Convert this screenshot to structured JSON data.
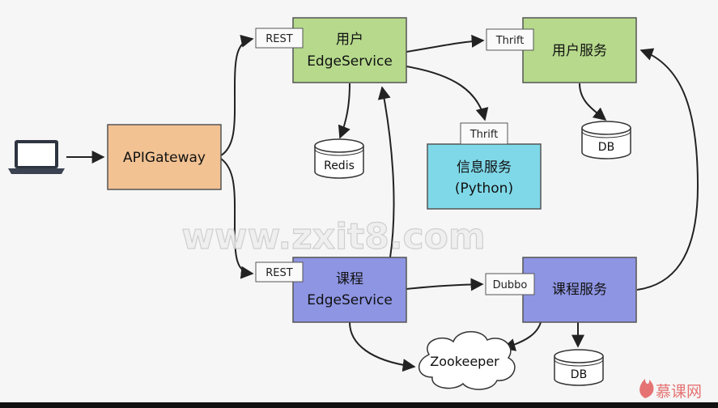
{
  "colors": {
    "api_gateway": "#f2c293",
    "user_nodes": "#b6d98c",
    "course_nodes": "#8e95e3",
    "info_service": "#7fd8e8",
    "border": "#555555",
    "arrow": "#222222"
  },
  "icons": {
    "client": "laptop-icon",
    "logo": "flame-icon"
  },
  "nodes": {
    "api_gateway": "APIGateway",
    "user_edge_line1": "用户",
    "user_edge_line2": "EdgeService",
    "user_service": "用户服务",
    "info_service_line1": "信息服务",
    "info_service_line2": "(Python)",
    "course_edge_line1": "课程",
    "course_edge_line2": "EdgeService",
    "course_service": "课程服务",
    "zookeeper": "Zookeeper"
  },
  "protocol_labels": {
    "user_rest": "REST",
    "course_rest": "REST",
    "user_thrift": "Thrift",
    "info_thrift": "Thrift",
    "course_dubbo": "Dubbo"
  },
  "datastores": {
    "redis": "Redis",
    "user_db": "DB",
    "course_db": "DB"
  },
  "watermark": "www.zxit8.com",
  "logo_text": "慕课网"
}
